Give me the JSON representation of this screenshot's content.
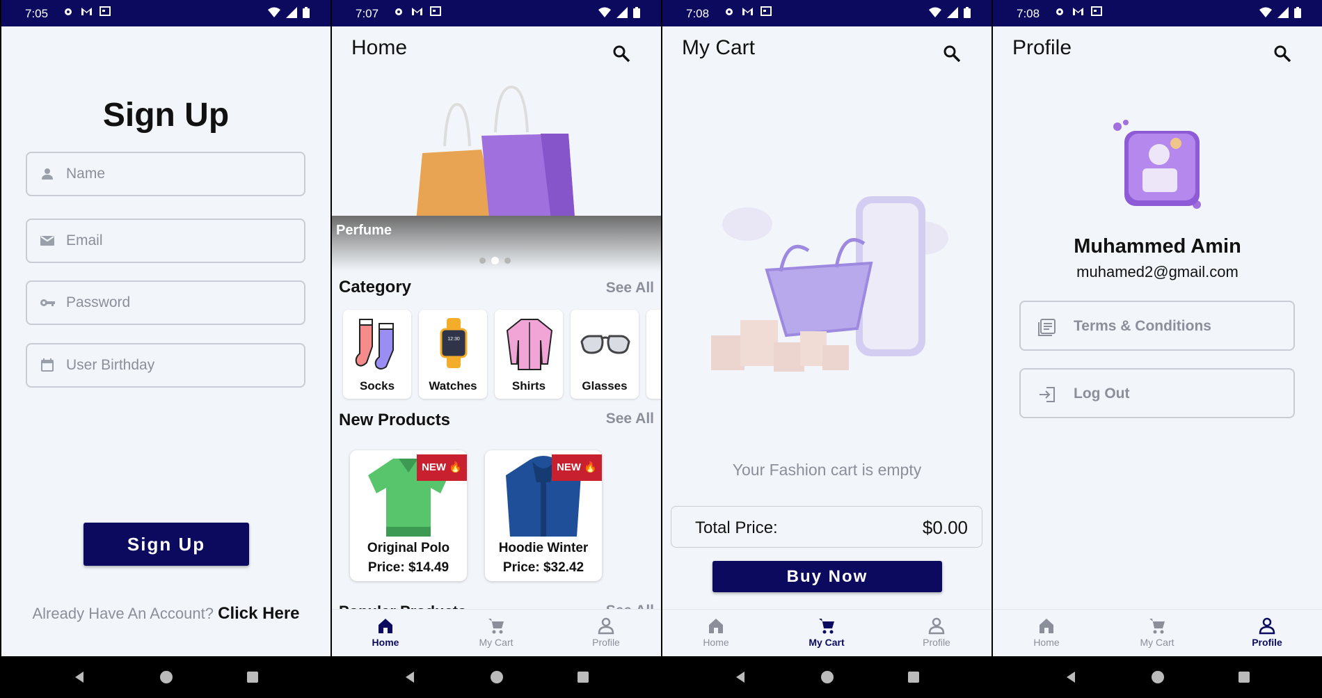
{
  "colors": {
    "primary": "#0b0a5e",
    "background": "#f2f6fa",
    "muted": "#8a8f99",
    "badge": "#c8202e"
  },
  "screens": [
    {
      "status_time": "7:05",
      "title": "Sign Up",
      "fields": [
        {
          "placeholder": "Name",
          "icon": "person-icon"
        },
        {
          "placeholder": "Email",
          "icon": "mail-icon"
        },
        {
          "placeholder": "Password",
          "icon": "key-icon"
        },
        {
          "placeholder": "User Birthday",
          "icon": "calendar-icon"
        }
      ],
      "button": "Sign Up",
      "footer_text": "Already Have An Account?",
      "footer_link": "Click Here"
    },
    {
      "status_time": "7:07",
      "title": "Home",
      "banner_label": "Perfume",
      "carousel_active_index": 1,
      "category_title": "Category",
      "see_all": "See All",
      "categories": [
        "Socks",
        "Watches",
        "Shirts",
        "Glasses"
      ],
      "watch_face": "12:30",
      "new_products_title": "New Products",
      "products": [
        {
          "badge": "NEW 🔥",
          "name": "Original Polo",
          "price": "Price: $14.49"
        },
        {
          "badge": "NEW 🔥",
          "name": "Hoodie Winter",
          "price": "Price: $32.42"
        }
      ],
      "cutoff_title": "Popular Products",
      "cutoff_see_all": "See All"
    },
    {
      "status_time": "7:08",
      "title": "My Cart",
      "empty_message": "Your Fashion cart is empty",
      "total_label": "Total Price:",
      "total_value": "$0.00",
      "button": "Buy Now"
    },
    {
      "status_time": "7:08",
      "title": "Profile",
      "name": "Muhammed Amin",
      "email": "muhamed2@gmail.com",
      "options": [
        {
          "label": "Terms & Conditions",
          "icon": "document-icon"
        },
        {
          "label": "Log Out",
          "icon": "logout-icon"
        }
      ]
    }
  ],
  "bottom_nav": [
    {
      "label": "Home",
      "icon": "home-icon"
    },
    {
      "label": "My Cart",
      "icon": "cart-icon"
    },
    {
      "label": "Profile",
      "icon": "person-icon"
    }
  ]
}
